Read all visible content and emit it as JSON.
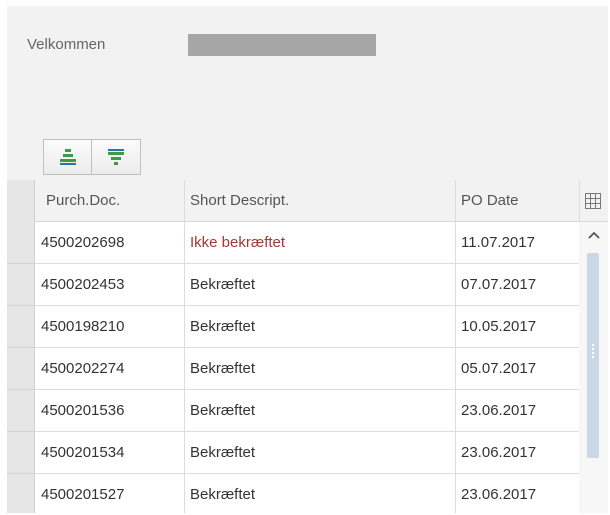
{
  "header": {
    "welcome_label": "Velkommen"
  },
  "toolbar": {
    "buttons": [
      {
        "icon": "sort-icon"
      },
      {
        "icon": "filter-icon"
      }
    ]
  },
  "table": {
    "columns": [
      "Purch.Doc.",
      "Short Descript.",
      "PO Date"
    ],
    "rows": [
      {
        "doc": "4500202698",
        "desc": "Ikke bekræftet",
        "date": "11.07.2017"
      },
      {
        "doc": "4500202453",
        "desc": "Bekræftet",
        "date": "07.07.2017"
      },
      {
        "doc": "4500198210",
        "desc": "Bekræftet",
        "date": "10.05.2017"
      },
      {
        "doc": "4500202274",
        "desc": "Bekræftet",
        "date": "05.07.2017"
      },
      {
        "doc": "4500201536",
        "desc": "Bekræftet",
        "date": "23.06.2017"
      },
      {
        "doc": "4500201534",
        "desc": "Bekræftet",
        "date": "23.06.2017"
      },
      {
        "doc": "4500201527",
        "desc": "Bekræftet",
        "date": "23.06.2017"
      }
    ]
  },
  "colors": {
    "unconfirmed_text": "#a33a2f",
    "icon_green": "#3d9a45",
    "scroll_thumb": "#c9d7e6"
  }
}
